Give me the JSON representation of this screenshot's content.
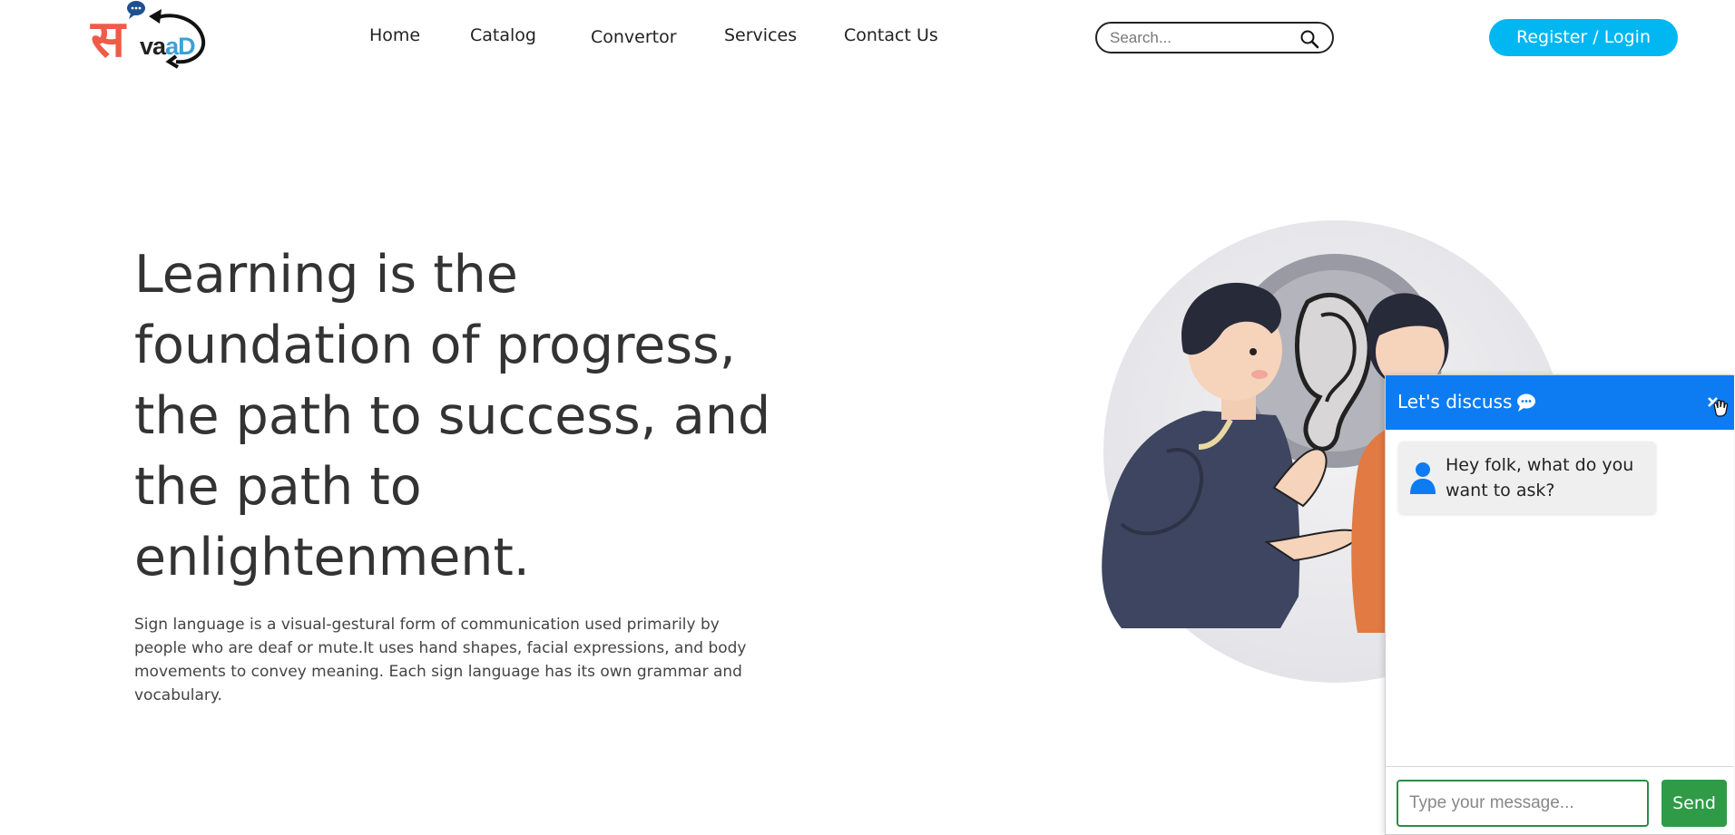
{
  "brand": {
    "logo_lettering": "सvaaD",
    "colors": {
      "sa": "#ef5b48",
      "accent": "#3ea0d6"
    }
  },
  "nav": {
    "items": [
      {
        "label": "Home"
      },
      {
        "label": "Catalog"
      },
      {
        "label": "Convertor"
      },
      {
        "label": "Services"
      },
      {
        "label": "Contact Us"
      }
    ]
  },
  "search": {
    "placeholder": "Search...",
    "value": "",
    "icon": "search-icon"
  },
  "header": {
    "register_label": "Register / Login",
    "register_color": "#00b7f1"
  },
  "hero": {
    "title": "Learning is the foundation of progress, the path to success, and the path to enlightenment.",
    "description": "Sign language is a visual-gestural form of communication used primarily by people who are deaf or mute.It uses hand shapes, facial expressions, and body movements to convey meaning. Each sign language has its own grammar and vocabulary."
  },
  "chat": {
    "title": "Let's discuss",
    "title_icon": "chat-bubble-icon",
    "close_icon": "close-icon",
    "header_color": "#0d7cf2",
    "messages": [
      {
        "sender_icon": "user-icon",
        "text": "Hey folk, what do you want to ask?"
      }
    ],
    "input_placeholder": "Type your message...",
    "input_value": "",
    "send_label": "Send",
    "send_color": "#2f9b47"
  }
}
